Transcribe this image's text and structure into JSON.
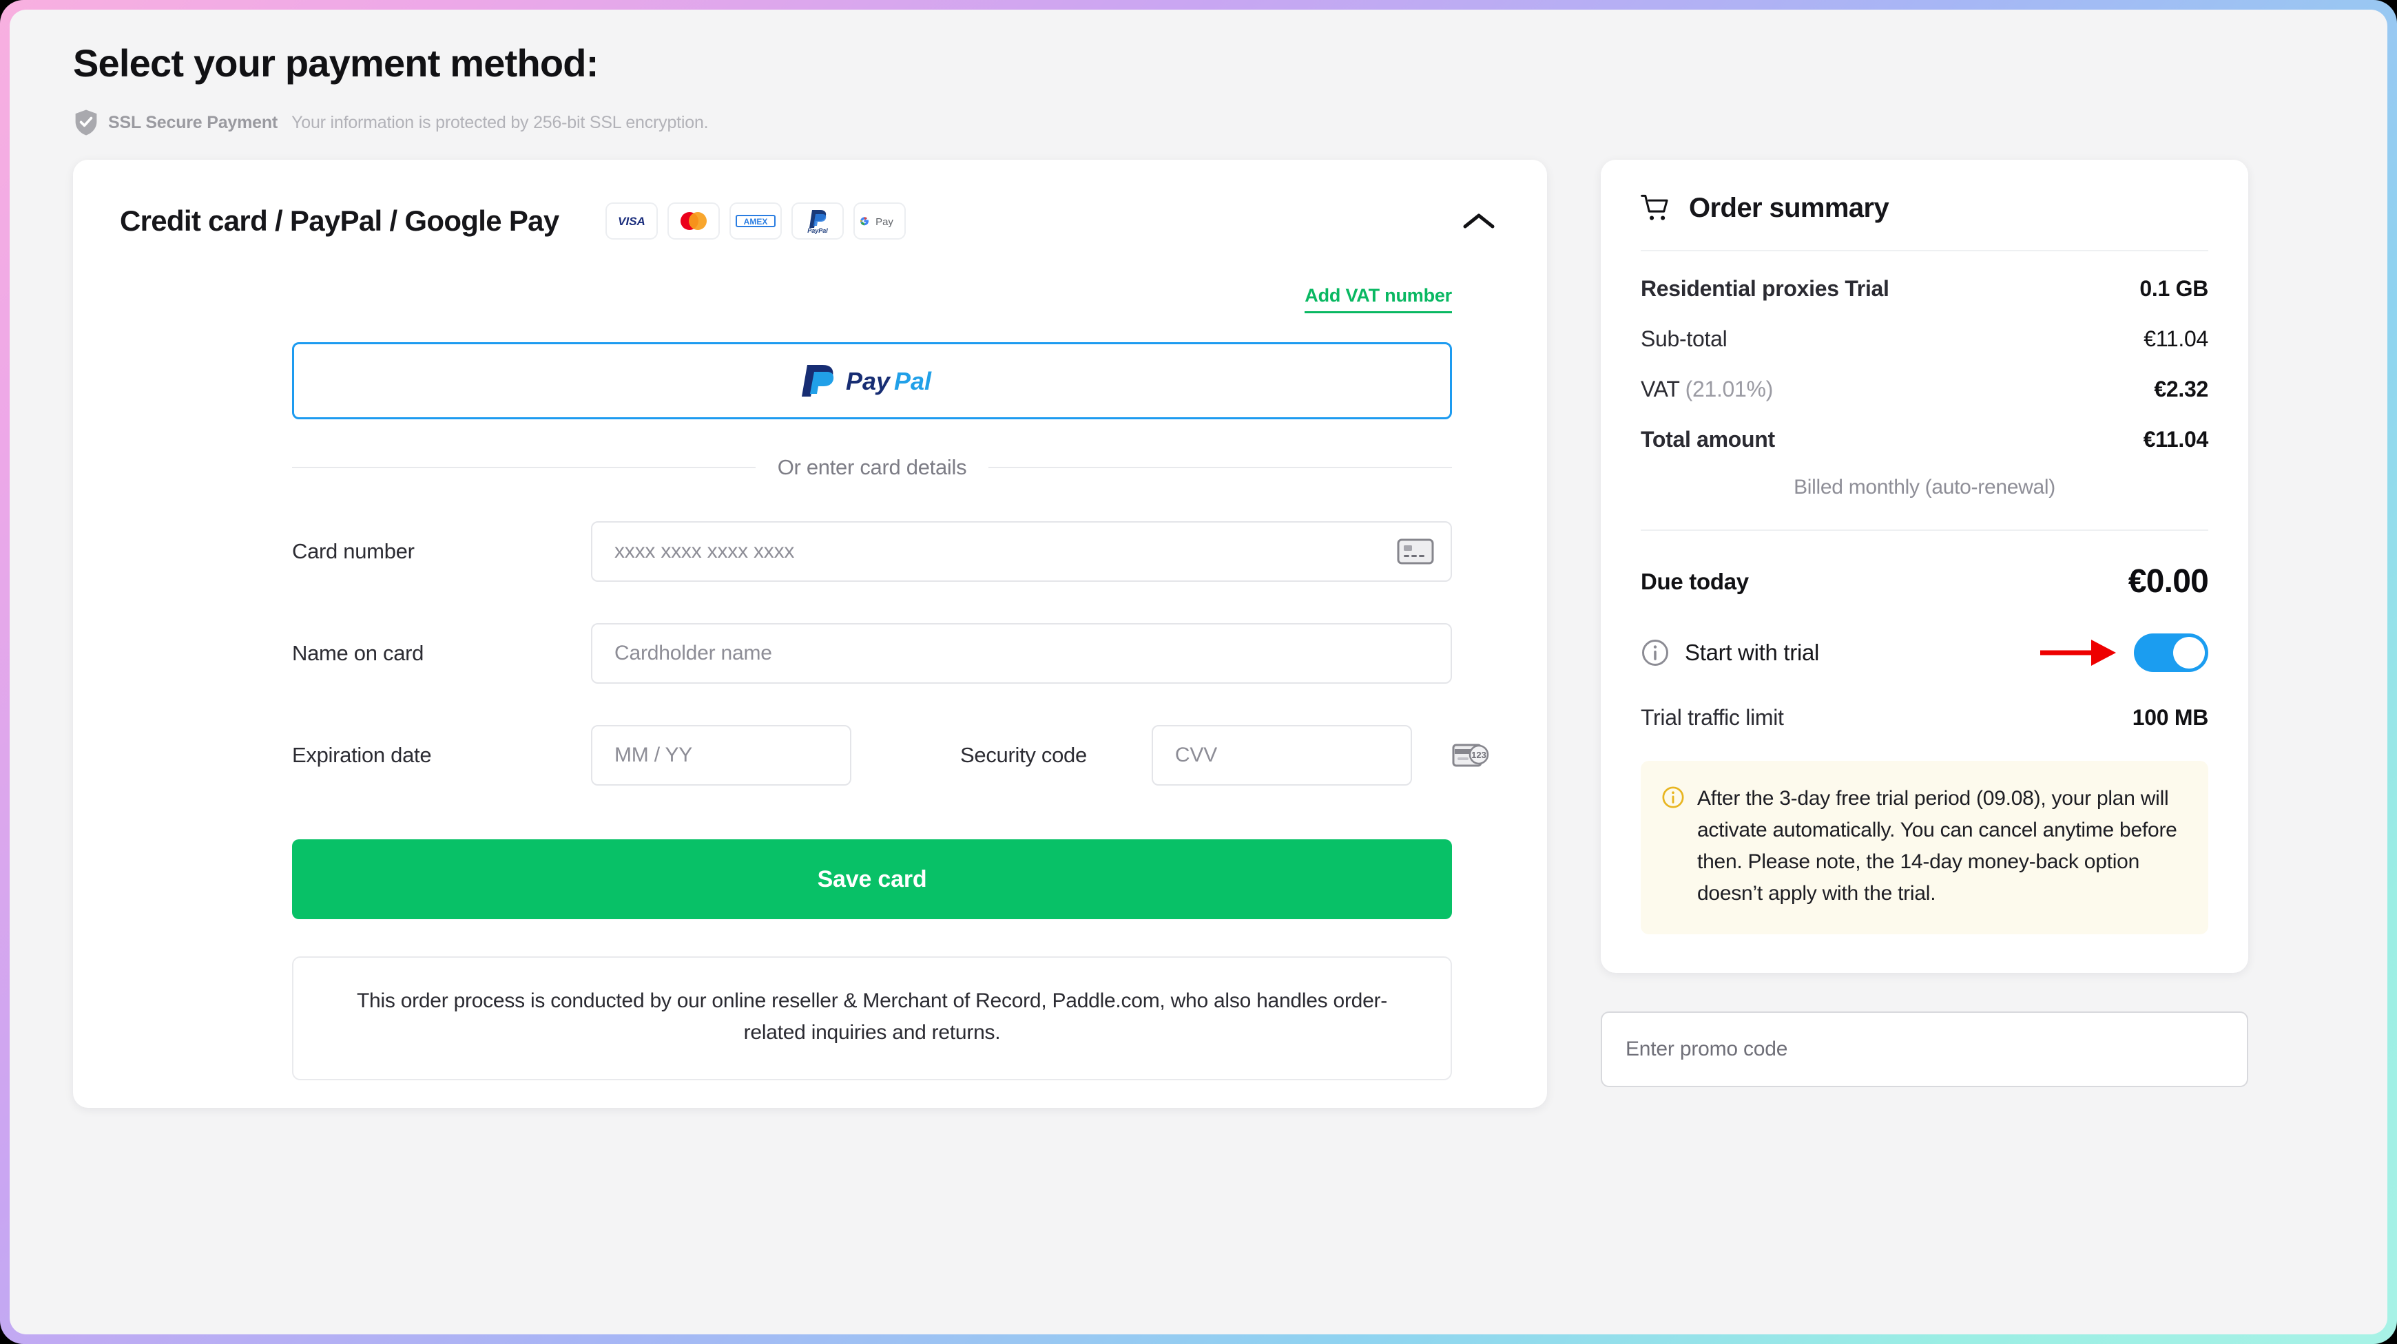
{
  "header": {
    "title": "Select your payment method:",
    "ssl_badge_strong": "SSL Secure Payment",
    "ssl_badge_text": "Your information is protected by 256-bit SSL encryption."
  },
  "payment_card": {
    "title": "Credit card / PayPal / Google Pay",
    "brands": [
      "VISA",
      "Mastercard",
      "AMEX",
      "PayPal",
      "G Pay"
    ],
    "collapse_icon": "chevron-up-icon",
    "vat_link": "Add VAT number",
    "paypal_button_label": "PayPal",
    "divider_label": "Or enter card details",
    "fields": {
      "card_number_label": "Card number",
      "card_number_placeholder": "xxxx xxxx xxxx xxxx",
      "card_number_value": "",
      "name_label": "Name on card",
      "name_placeholder": "Cardholder name",
      "name_value": "",
      "expiry_label": "Expiration date",
      "expiry_placeholder": "MM / YY",
      "expiry_value": "",
      "cvv_label": "Security code",
      "cvv_placeholder": "CVV",
      "cvv_value": ""
    },
    "save_button": "Save card",
    "disclaimer": "This order process is conducted by our online reseller & Merchant of Record, Paddle.com, who also handles order-related inquiries and returns."
  },
  "order_summary": {
    "title": "Order summary",
    "cart_icon": "shopping-cart-icon",
    "product_name": "Residential proxies Trial",
    "product_amount": "0.1 GB",
    "lines": [
      {
        "label": "Sub-total",
        "value": "€11.04"
      }
    ],
    "vat_label": "VAT",
    "vat_percent": "(21.01%)",
    "vat_value": "€2.32",
    "total_label": "Total amount",
    "total_value": "€11.04",
    "billed_note": "Billed monthly (auto-renewal)",
    "due_today_label": "Due today",
    "due_today_value": "€0.00",
    "trial_toggle_label": "Start with trial",
    "trial_toggle_state": "on",
    "trial_info_icon": "info-circle-icon",
    "trial_limit_label": "Trial traffic limit",
    "trial_limit_value": "100 MB",
    "notice_icon": "info-circle-icon",
    "notice_text": "After the 3-day free trial period (09.08), your plan will activate automatically. You can cancel anytime before then. Please note, the 14-day money-back option doesn’t apply with the trial.",
    "promo_placeholder": "Enter promo code"
  },
  "annotation": {
    "arrow_color": "#ee0000",
    "arrow_target": "trial-toggle"
  },
  "colors": {
    "accent_green": "#08c167",
    "toggle_blue": "#1b9df0",
    "vat_link_green": "#09b862",
    "notice_bg": "#fdfaed",
    "page_bg": "#f4f4f5"
  }
}
